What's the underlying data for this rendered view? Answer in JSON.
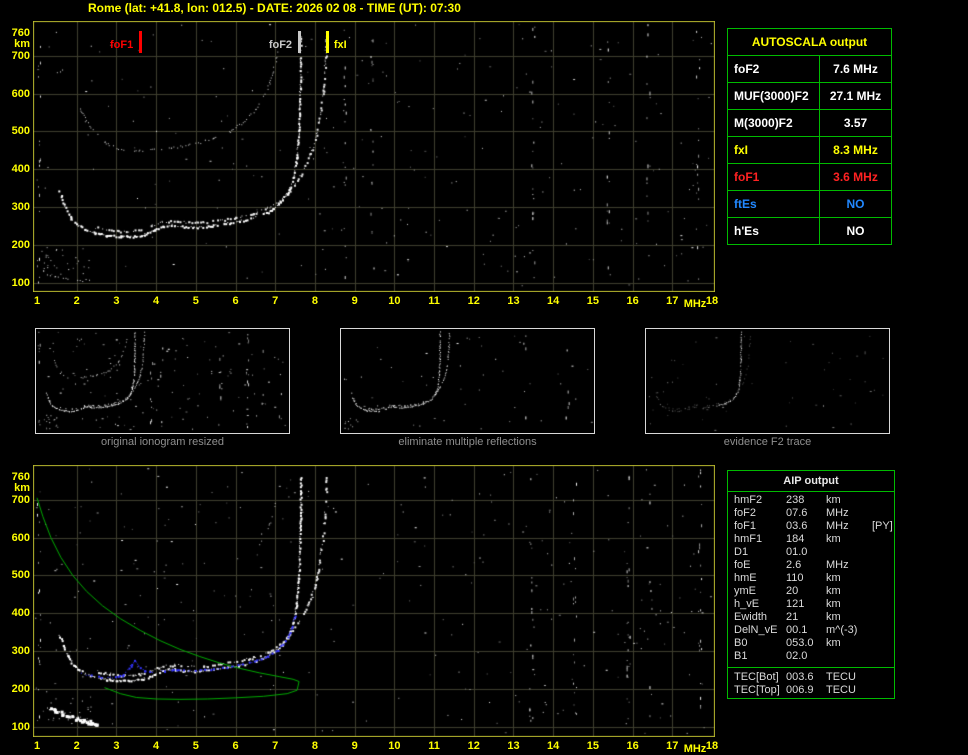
{
  "window": {
    "title": "Rome (lat: +41.8, lon: 012.5) - DATE: 2026 02 08 - TIME (UT): 07:30"
  },
  "colors": {
    "background": "#000000",
    "title_yellow": "#ffff00",
    "plot_border": "#b9b92e",
    "grid": "#3f3f2f",
    "axis_label": "#ffff00",
    "table_border": "#00bb00",
    "trace_white": "#ffffff",
    "profile_green": "#00aa00",
    "scaled_trace_blue": "#3434ff",
    "caption_gray": "#8f8f8f",
    "aip_text": "#dadada",
    "thumb_border": "#d8d8d8"
  },
  "autoscala_table": {
    "title": "AUTOSCALA output",
    "rows": [
      {
        "label": "foF2",
        "value": "7.6 MHz",
        "color": "#ffffff"
      },
      {
        "label": "MUF(3000)F2",
        "value": "27.1 MHz",
        "color": "#ffffff"
      },
      {
        "label": "M(3000)F2",
        "value": "3.57",
        "color": "#ffffff"
      },
      {
        "label": "fxI",
        "value": "8.3 MHz",
        "color": "#ffff00"
      },
      {
        "label": "foF1",
        "value": "3.6 MHz",
        "color": "#ff2222"
      },
      {
        "label": "ftEs",
        "value": "NO",
        "color": "#2288ff"
      },
      {
        "label": "h'Es",
        "value": "NO",
        "color": "#ffffff"
      }
    ]
  },
  "thumbnails": [
    {
      "caption": "original ionogram resized"
    },
    {
      "caption": "eliminate multiple reflections"
    },
    {
      "caption": "evidence F2 trace"
    }
  ],
  "aip_table": {
    "title": "AIP output",
    "rows": [
      {
        "name": "hmF2",
        "value": "238",
        "unit": "km",
        "extra": ""
      },
      {
        "name": "foF2",
        "value": "07.6",
        "unit": "MHz",
        "extra": ""
      },
      {
        "name": "foF1",
        "value": "03.6",
        "unit": "MHz",
        "extra": "[PY]"
      },
      {
        "name": "hmF1",
        "value": "184",
        "unit": "km",
        "extra": ""
      },
      {
        "name": "D1",
        "value": "01.0",
        "unit": "",
        "extra": ""
      },
      {
        "name": "foE",
        "value": "2.6",
        "unit": "MHz",
        "extra": ""
      },
      {
        "name": "hmE",
        "value": "110",
        "unit": "km",
        "extra": ""
      },
      {
        "name": "ymE",
        "value": "20",
        "unit": "km",
        "extra": ""
      },
      {
        "name": "h_vE",
        "value": "121",
        "unit": "km",
        "extra": ""
      },
      {
        "name": "Ewidth",
        "value": "21",
        "unit": "km",
        "extra": ""
      },
      {
        "name": "DelN_vE",
        "value": "00.1",
        "unit": "m^(-3)",
        "extra": ""
      },
      {
        "name": "B0",
        "value": "053.0",
        "unit": "km",
        "extra": ""
      },
      {
        "name": "B1",
        "value": "02.0",
        "unit": "",
        "extra": ""
      }
    ],
    "tec_rows": [
      {
        "name": "TEC[Bot]",
        "value": "003.6",
        "unit": "TECU",
        "extra": ""
      },
      {
        "name": "TEC[Top]",
        "value": "006.9",
        "unit": "TECU",
        "extra": ""
      }
    ]
  },
  "chart_data": [
    {
      "type": "scatter",
      "name": "autoscala scaled ionogram (top)",
      "xlabel": "MHz",
      "ylabel": "km",
      "xlim": [
        1,
        18
      ],
      "ylim": [
        100,
        760
      ],
      "x_ticks": [
        1,
        2,
        3,
        4,
        5,
        6,
        7,
        8,
        9,
        10,
        11,
        12,
        13,
        14,
        15,
        16,
        17,
        18
      ],
      "y_ticks": [
        760,
        700,
        600,
        500,
        400,
        300,
        200,
        100
      ],
      "grid": true,
      "legend": "none",
      "markers": [
        {
          "label": "foF1",
          "freq": 3.6,
          "color": "#ff0000",
          "value_mhz": 3.6
        },
        {
          "label": "foF2",
          "freq": 7.6,
          "color": "#c8c8c8",
          "value_mhz": 7.6
        },
        {
          "label": "fxI",
          "freq": 8.3,
          "color": "#ffff00",
          "value_mhz": 8.3
        }
      ],
      "series": [
        {
          "name": "multiple-reflection-2nd-hop",
          "points": [
            [
              2.05,
              565
            ],
            [
              2.35,
              512
            ],
            [
              2.7,
              472
            ],
            [
              3.05,
              455
            ],
            [
              3.45,
              450
            ],
            [
              3.9,
              452
            ],
            [
              4.3,
              457
            ],
            [
              4.7,
              462
            ],
            [
              5.05,
              470
            ],
            [
              5.45,
              482
            ],
            [
              5.85,
              500
            ],
            [
              6.2,
              527
            ],
            [
              6.5,
              560
            ],
            [
              6.75,
              602
            ],
            [
              6.95,
              658
            ],
            [
              7.05,
              710
            ]
          ]
        },
        {
          "name": "F-trace-extraordinary",
          "points": [
            [
              2.5,
              247
            ],
            [
              2.9,
              239
            ],
            [
              3.3,
              237
            ],
            [
              3.6,
              241
            ],
            [
              3.9,
              252
            ],
            [
              4.15,
              262
            ],
            [
              4.45,
              265
            ],
            [
              4.8,
              261
            ],
            [
              5.2,
              262
            ],
            [
              5.6,
              267
            ],
            [
              6.0,
              274
            ],
            [
              6.45,
              285
            ],
            [
              6.8,
              299
            ],
            [
              7.1,
              318
            ],
            [
              7.35,
              345
            ],
            [
              7.6,
              382
            ],
            [
              7.8,
              420
            ],
            [
              7.98,
              470
            ],
            [
              8.1,
              530
            ],
            [
              8.2,
              610
            ],
            [
              8.26,
              700
            ],
            [
              8.28,
              760
            ]
          ]
        },
        {
          "name": "F-trace-ordinary",
          "points": [
            [
              1.55,
              345
            ],
            [
              1.65,
              315
            ],
            [
              1.75,
              292
            ],
            [
              1.85,
              272
            ],
            [
              2.0,
              256
            ],
            [
              2.2,
              243
            ],
            [
              2.45,
              233
            ],
            [
              2.75,
              227
            ],
            [
              3.1,
              224
            ],
            [
              3.45,
              224
            ],
            [
              3.7,
              229
            ],
            [
              3.95,
              241
            ],
            [
              4.15,
              251
            ],
            [
              4.4,
              254
            ],
            [
              4.65,
              250
            ],
            [
              4.95,
              248
            ],
            [
              5.3,
              251
            ],
            [
              5.7,
              257
            ],
            [
              6.1,
              264
            ],
            [
              6.5,
              275
            ],
            [
              6.85,
              291
            ],
            [
              7.1,
              310
            ],
            [
              7.3,
              338
            ],
            [
              7.45,
              378
            ],
            [
              7.53,
              430
            ],
            [
              7.58,
              495
            ],
            [
              7.61,
              575
            ],
            [
              7.625,
              660
            ],
            [
              7.63,
              760
            ]
          ]
        },
        {
          "name": "E-region-echoes",
          "points": [
            [
              1.0,
              135
            ],
            [
              1.45,
              120
            ],
            [
              1.9,
              112
            ],
            [
              2.35,
              106
            ]
          ]
        }
      ],
      "noise_columns": [
        1.05,
        8.75,
        9.45,
        13.5,
        15.4,
        16.4,
        17.65
      ],
      "clusters": [
        {
          "f": [
            1.0,
            2.4
          ],
          "km": [
            100,
            195
          ],
          "n": 30
        }
      ],
      "speckle_count": 240
    },
    {
      "type": "scatter",
      "name": "AIP inversion ionogram (bottom)",
      "xlabel": "MHz",
      "ylabel": "km",
      "xlim": [
        1,
        18
      ],
      "ylim": [
        100,
        760
      ],
      "x_ticks": [
        1,
        2,
        3,
        4,
        5,
        6,
        7,
        8,
        9,
        10,
        11,
        12,
        13,
        14,
        15,
        16,
        17,
        18
      ],
      "y_ticks": [
        760,
        700,
        600,
        500,
        400,
        300,
        200,
        100
      ],
      "grid": true,
      "legend": "none",
      "series": [
        {
          "name": "second-hop-residual",
          "points": [
            [
              6.6,
              585
            ],
            [
              6.85,
              635
            ],
            [
              7.0,
              700
            ]
          ]
        },
        {
          "name": "F-trace-extraordinary",
          "points": [
            [
              2.5,
              247
            ],
            [
              2.9,
              239
            ],
            [
              3.3,
              237
            ],
            [
              3.6,
              241
            ],
            [
              3.9,
              252
            ],
            [
              4.15,
              262
            ],
            [
              4.45,
              265
            ],
            [
              4.8,
              261
            ],
            [
              5.2,
              262
            ],
            [
              5.6,
              267
            ],
            [
              6.0,
              274
            ],
            [
              6.45,
              285
            ],
            [
              6.8,
              299
            ],
            [
              7.1,
              318
            ],
            [
              7.35,
              345
            ],
            [
              7.6,
              382
            ],
            [
              7.8,
              420
            ],
            [
              7.98,
              470
            ],
            [
              8.1,
              530
            ],
            [
              8.2,
              610
            ],
            [
              8.26,
              700
            ],
            [
              8.28,
              760
            ]
          ]
        },
        {
          "name": "F-trace-ordinary",
          "points": [
            [
              1.55,
              345
            ],
            [
              1.65,
              315
            ],
            [
              1.75,
              292
            ],
            [
              1.85,
              272
            ],
            [
              2.0,
              256
            ],
            [
              2.2,
              243
            ],
            [
              2.45,
              233
            ],
            [
              2.75,
              227
            ],
            [
              3.1,
              224
            ],
            [
              3.45,
              224
            ],
            [
              3.7,
              229
            ],
            [
              3.95,
              241
            ],
            [
              4.15,
              251
            ],
            [
              4.4,
              254
            ],
            [
              4.65,
              250
            ],
            [
              4.95,
              248
            ],
            [
              5.3,
              251
            ],
            [
              5.7,
              257
            ],
            [
              6.1,
              264
            ],
            [
              6.5,
              275
            ],
            [
              6.85,
              291
            ],
            [
              7.1,
              310
            ],
            [
              7.3,
              338
            ],
            [
              7.45,
              378
            ],
            [
              7.53,
              430
            ],
            [
              7.58,
              495
            ],
            [
              7.61,
              575
            ],
            [
              7.625,
              660
            ],
            [
              7.63,
              760
            ]
          ]
        },
        {
          "name": "E-trace-blob",
          "points": [
            [
              1.25,
              152
            ],
            [
              1.55,
              140
            ],
            [
              1.85,
              128
            ],
            [
              2.15,
              118
            ],
            [
              2.5,
              110
            ]
          ]
        }
      ],
      "profile_green": [
        [
          1.0,
          705
        ],
        [
          1.15,
          655
        ],
        [
          1.35,
          600
        ],
        [
          1.6,
          548
        ],
        [
          1.9,
          500
        ],
        [
          2.25,
          458
        ],
        [
          2.65,
          420
        ],
        [
          3.1,
          386
        ],
        [
          3.6,
          355
        ],
        [
          4.1,
          328
        ],
        [
          4.6,
          305
        ],
        [
          5.1,
          286
        ],
        [
          5.6,
          269
        ],
        [
          6.1,
          255
        ],
        [
          6.6,
          243
        ],
        [
          7.1,
          233
        ],
        [
          7.45,
          226
        ],
        [
          7.6,
          220
        ]
      ],
      "profile_green_lower": [
        [
          2.7,
          204
        ],
        [
          3.1,
          188
        ],
        [
          3.5,
          178
        ],
        [
          4.0,
          174
        ],
        [
          4.6,
          173
        ],
        [
          5.3,
          174
        ],
        [
          6.0,
          177
        ],
        [
          6.7,
          181
        ],
        [
          7.3,
          188
        ],
        [
          7.55,
          197
        ],
        [
          7.6,
          220
        ]
      ],
      "scaled_trace_blue": [
        [
          2.05,
          244
        ],
        [
          2.3,
          238
        ],
        [
          2.6,
          233
        ],
        [
          2.9,
          231
        ],
        [
          3.15,
          238
        ],
        [
          3.35,
          262
        ],
        [
          3.45,
          276
        ],
        [
          3.55,
          262
        ],
        [
          3.7,
          248
        ],
        [
          3.95,
          246
        ],
        [
          4.2,
          250
        ],
        [
          4.5,
          252
        ],
        [
          4.85,
          250
        ],
        [
          5.2,
          252
        ],
        [
          5.6,
          257
        ],
        [
          6.0,
          263
        ],
        [
          6.4,
          272
        ],
        [
          6.8,
          288
        ],
        [
          7.05,
          305
        ],
        [
          7.25,
          330
        ],
        [
          7.4,
          362
        ],
        [
          7.5,
          400
        ]
      ],
      "noise_columns": [
        1.05,
        13.45,
        14.55,
        15.9,
        16.45,
        17.7
      ],
      "clusters": [
        {
          "f": [
            1.0,
            2.6
          ],
          "km": [
            100,
            200
          ],
          "n": 22
        }
      ],
      "speckle_count": 300
    }
  ]
}
